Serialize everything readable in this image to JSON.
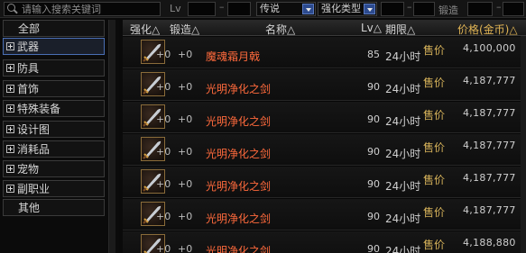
{
  "filters": {
    "search_placeholder": "请输入搜索关键词",
    "lv_label": "Lv",
    "rarity": "传说",
    "enhance_type": "强化类型",
    "lock_label": "锻造"
  },
  "categories": [
    {
      "label": "全部",
      "expandable": false
    },
    {
      "label": "武器",
      "expandable": true
    },
    {
      "label": "防具",
      "expandable": true
    },
    {
      "label": "首饰",
      "expandable": true
    },
    {
      "label": "特殊装备",
      "expandable": true
    },
    {
      "label": "设计图",
      "expandable": true
    },
    {
      "label": "消耗品",
      "expandable": true
    },
    {
      "label": "宠物",
      "expandable": true
    },
    {
      "label": "副职业",
      "expandable": true
    },
    {
      "label": "其他",
      "expandable": false
    }
  ],
  "table": {
    "headers": {
      "enhance": "强化△",
      "forge": "锻造△",
      "name": "名称△",
      "lv": "Lv△",
      "duration": "期限△",
      "price": "价格(金币)△"
    },
    "rows": [
      {
        "enhance": "+0",
        "forge": "+0",
        "name": "魔魂霜月戟",
        "lv": "85",
        "duration": "24小时",
        "price_type": "售价",
        "price": "4,100,000"
      },
      {
        "enhance": "+0",
        "forge": "+0",
        "name": "光明净化之剑",
        "lv": "90",
        "duration": "24小时",
        "price_type": "售价",
        "price": "4,187,777"
      },
      {
        "enhance": "+0",
        "forge": "+0",
        "name": "光明净化之剑",
        "lv": "90",
        "duration": "24小时",
        "price_type": "售价",
        "price": "4,187,777"
      },
      {
        "enhance": "+0",
        "forge": "+0",
        "name": "光明净化之剑",
        "lv": "90",
        "duration": "24小时",
        "price_type": "售价",
        "price": "4,187,777"
      },
      {
        "enhance": "+0",
        "forge": "+0",
        "name": "光明净化之剑",
        "lv": "90",
        "duration": "24小时",
        "price_type": "售价",
        "price": "4,187,777"
      },
      {
        "enhance": "+0",
        "forge": "+0",
        "name": "光明净化之剑",
        "lv": "90",
        "duration": "24小时",
        "price_type": "售价",
        "price": "4,187,777"
      },
      {
        "enhance": "+0",
        "forge": "+0",
        "name": "光明净化之剑",
        "lv": "90",
        "duration": "24小时",
        "price_type": "售价",
        "price": "4,188,880"
      }
    ]
  },
  "colors": {
    "item_name": "#ff6a3c",
    "price_label": "#d6b25a",
    "selected_border": "#4a6fb5"
  }
}
